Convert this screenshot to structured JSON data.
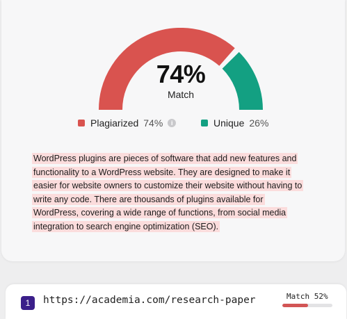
{
  "result": {
    "percent": "74%",
    "percent_value": 74,
    "label": "Match",
    "colors": {
      "plagiarized": "#d9534f",
      "unique": "#13a082"
    }
  },
  "legend": {
    "plagiarized_label": "Plagiarized",
    "plagiarized_value": "74%",
    "info_icon": "info-icon",
    "unique_label": "Unique",
    "unique_value": "26%"
  },
  "text": "WordPress plugins are pieces of software that add new features and functionality to a WordPress website. They are designed to make it easier for website owners to customize their website without having to write any code. There are thousands of plugins available for WordPress, covering a wide range of functions, from social media integration to search engine optimization (SEO).",
  "source": {
    "index": "1",
    "url": "https://academia.com/research-paper",
    "match_label": "Match 52%",
    "match_value": 52
  }
}
